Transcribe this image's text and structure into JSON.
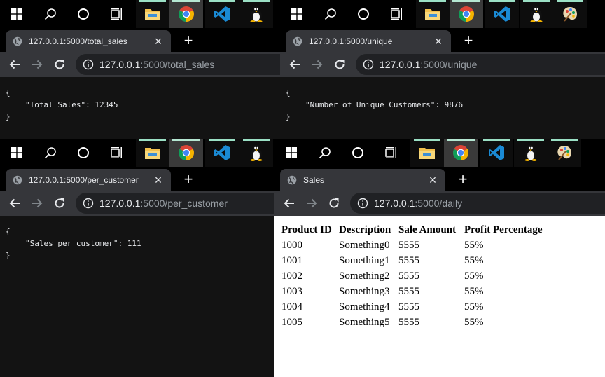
{
  "windows": [
    {
      "tab_title": "127.0.0.1:5000/total_sales",
      "url_host": "127.0.0.1",
      "url_rest": ":5000/total_sales",
      "json_lines": [
        "{",
        "\"Total Sales\": 12345",
        "}"
      ]
    },
    {
      "tab_title": "127.0.0.1:5000/unique",
      "url_host": "127.0.0.1",
      "url_rest": ":5000/unique",
      "json_lines": [
        "{",
        "\"Number of Unique Customers\": 9876",
        "}"
      ]
    },
    {
      "tab_title": "127.0.0.1:5000/per_customer",
      "url_host": "127.0.0.1",
      "url_rest": ":5000/per_customer",
      "json_lines": [
        "{",
        "\"Sales per customer\": 111",
        "}"
      ]
    },
    {
      "tab_title": "Sales",
      "url_host": "127.0.0.1",
      "url_rest": ":5000/daily",
      "table": {
        "headers": [
          "Product ID",
          "Description",
          "Sale Amount",
          "Profit Percentage"
        ],
        "rows": [
          [
            "1000",
            "Something0",
            "5555",
            "55%"
          ],
          [
            "1001",
            "Something1",
            "5555",
            "55%"
          ],
          [
            "1002",
            "Something2",
            "5555",
            "55%"
          ],
          [
            "1003",
            "Something3",
            "5555",
            "55%"
          ],
          [
            "1004",
            "Something4",
            "5555",
            "55%"
          ],
          [
            "1005",
            "Something5",
            "5555",
            "55%"
          ]
        ]
      }
    }
  ],
  "new_tab_label": "+",
  "close_tab_label": "×",
  "taskbar_icons": [
    "windows-start-icon",
    "search-icon",
    "cortana-icon",
    "task-view-icon",
    "file-explorer-icon",
    "chrome-icon",
    "vscode-icon",
    "linux-tux-icon",
    "paint-icon"
  ],
  "colors": {
    "tab": "#35363a",
    "omnibox": "#202124",
    "taskbar_indicator": "#9be0c5",
    "vscode": "#1a8ad4",
    "folder": "#f2c14e"
  }
}
